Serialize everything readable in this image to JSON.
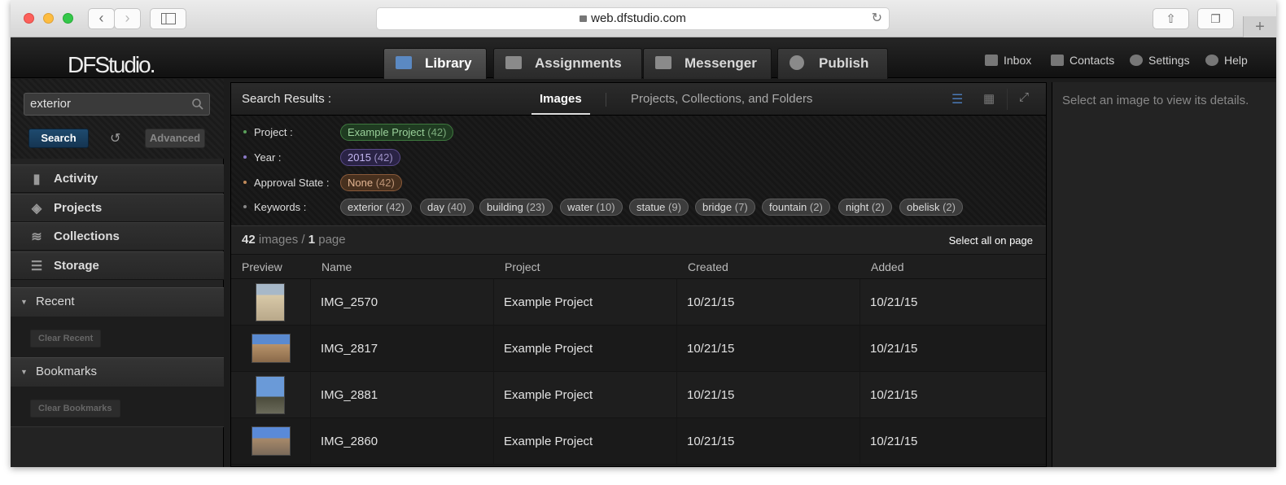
{
  "browser": {
    "url": "web.dfstudio.com"
  },
  "app": {
    "logo": "DFStudio.",
    "tabs": [
      {
        "label": "Library",
        "active": true
      },
      {
        "label": "Assignments",
        "active": false
      },
      {
        "label": "Messenger",
        "active": false
      },
      {
        "label": "Publish",
        "active": false
      }
    ],
    "header_links": [
      "Inbox",
      "Contacts",
      "Settings",
      "Help"
    ]
  },
  "sidebar": {
    "search_value": "exterior",
    "search_button": "Search",
    "advanced_button": "Advanced",
    "nav": [
      "Activity",
      "Projects",
      "Collections",
      "Storage"
    ],
    "recent": {
      "title": "Recent",
      "clear": "Clear Recent"
    },
    "bookmarks": {
      "title": "Bookmarks",
      "clear": "Clear Bookmarks"
    }
  },
  "results": {
    "title": "Search Results :",
    "tab_images": "Images",
    "tab_other": "Projects, Collections, and Folders",
    "filters": {
      "project_label": "Project :",
      "project_chip": {
        "name": "Example Project",
        "count": "(42)"
      },
      "year_label": "Year :",
      "year_chip": {
        "name": "2015",
        "count": "(42)"
      },
      "approval_label": "Approval State :",
      "approval_chip": {
        "name": "None",
        "count": "(42)"
      },
      "keywords_label": "Keywords :",
      "keywords": [
        {
          "name": "exterior",
          "count": "(42)"
        },
        {
          "name": "day",
          "count": "(40)"
        },
        {
          "name": "building",
          "count": "(23)"
        },
        {
          "name": "water",
          "count": "(10)"
        },
        {
          "name": "statue",
          "count": "(9)"
        },
        {
          "name": "bridge",
          "count": "(7)"
        },
        {
          "name": "fountain",
          "count": "(2)"
        },
        {
          "name": "night",
          "count": "(2)"
        },
        {
          "name": "obelisk",
          "count": "(2)"
        }
      ]
    },
    "count_images": "42",
    "images_word": "images",
    "separator": "/",
    "count_pages": "1",
    "page_word": "page",
    "select_all": "Select all on page",
    "columns": [
      "Preview",
      "Name",
      "Project",
      "Created",
      "Added"
    ],
    "rows": [
      {
        "name": "IMG_2570",
        "project": "Example Project",
        "created": "10/21/15",
        "added": "10/21/15"
      },
      {
        "name": "IMG_2817",
        "project": "Example Project",
        "created": "10/21/15",
        "added": "10/21/15"
      },
      {
        "name": "IMG_2881",
        "project": "Example Project",
        "created": "10/21/15",
        "added": "10/21/15"
      },
      {
        "name": "IMG_2860",
        "project": "Example Project",
        "created": "10/21/15",
        "added": "10/21/15"
      }
    ]
  },
  "details": {
    "placeholder": "Select an image to view its details."
  },
  "colors": {
    "project_chip": "#3f7a3f",
    "year_chip": "#5a4a8a",
    "approval_chip": "#8a5a3a",
    "accent_blue": "#4a7ab8"
  }
}
